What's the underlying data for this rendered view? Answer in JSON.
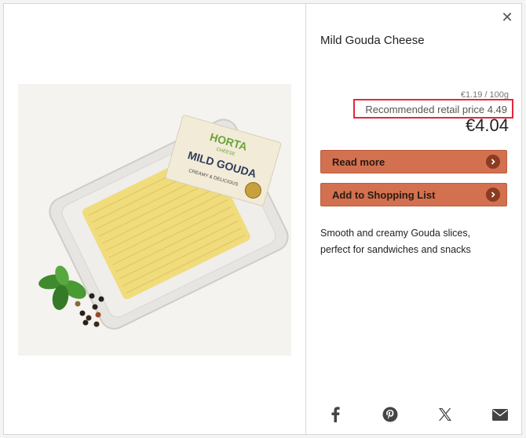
{
  "product": {
    "title": "Mild Gouda Cheese",
    "unit_price": "€1.19 / 100g",
    "recommended_retail_price": "Recommended retail price 4.49",
    "price": "€4.04",
    "description": "Smooth and creamy Gouda slices, perfect for sandwiches and snacks",
    "image": {
      "brand_text": "HORTA",
      "brand_sub": "CHEESE",
      "label_text": "MILD GOUDA",
      "label_sub": "CREAMY & DELICIOUS"
    }
  },
  "actions": {
    "read_more": "Read more",
    "add_to_list": "Add to Shopping List"
  },
  "share": {
    "icons": [
      "facebook-icon",
      "pinterest-icon",
      "x-icon",
      "email-icon"
    ]
  },
  "colors": {
    "button_bg": "#d2704f",
    "chevron_bg": "#8b3b22",
    "highlight_border": "#e5283a"
  }
}
